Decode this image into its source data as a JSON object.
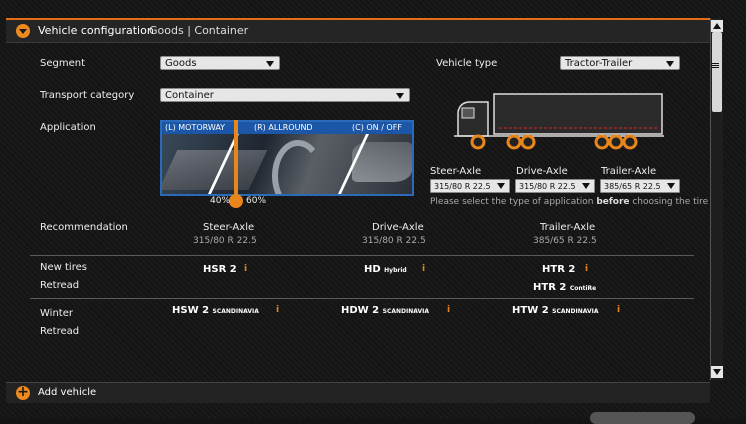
{
  "header": {
    "title": "Vehicle configuration",
    "subtitle": "Goods | Container"
  },
  "fields": {
    "segment_label": "Segment",
    "segment_value": "Goods",
    "transport_label": "Transport category",
    "transport_value": "Container",
    "application_label": "Application",
    "vehicle_type_label": "Vehicle type",
    "vehicle_type_value": "Tractor-Trailer"
  },
  "application": {
    "motorway": "(L) MOTORWAY",
    "allround": "(R) ALLROUND",
    "onoff": "(C) ON / OFF",
    "left_pct": "40%",
    "right_pct": "60%"
  },
  "axles": {
    "steer_label": "Steer-Axle",
    "steer_value": "315/80 R 22.5",
    "drive_label": "Drive-Axle",
    "drive_value": "315/80 R 22.5",
    "trailer_label": "Trailer-Axle",
    "trailer_value": "385/65 R 22.5",
    "note_pre": "Please select the type of application ",
    "note_bold": "before",
    "note_post": " choosing the tire siz"
  },
  "recommendation": {
    "label": "Recommendation",
    "cols": [
      {
        "title": "Steer-Axle",
        "size": "315/80 R 22.5"
      },
      {
        "title": "Drive-Axle",
        "size": "315/80 R 22.5"
      },
      {
        "title": "Trailer-Axle",
        "size": "385/65 R 22.5"
      }
    ]
  },
  "new_tires": {
    "label": "New tires",
    "retread_label": "Retread",
    "steer": "HSR 2",
    "drive": "HD",
    "drive_sub": "Hybrid",
    "trailer": "HTR 2",
    "retread_trailer": "HTR 2",
    "retread_trailer_sub": "ContiRe"
  },
  "winter": {
    "label": "Winter",
    "retread_label": "Retread",
    "steer": "HSW 2",
    "steer_sub": "SCANDINAVIA",
    "drive": "HDW 2",
    "drive_sub": "SCANDINAVIA",
    "trailer": "HTW 2",
    "trailer_sub": "SCANDINAVIA"
  },
  "info_glyph": "i",
  "bottom": {
    "add_vehicle": "Add vehicle"
  },
  "icons": {
    "header": "chevron-down-icon",
    "add": "plus-icon",
    "scroll_up": "arrow-up-icon",
    "scroll_down": "arrow-down-icon",
    "menu": "menu-icon"
  },
  "colors": {
    "accent": "#e36f16",
    "blue": "#1c56a6"
  }
}
